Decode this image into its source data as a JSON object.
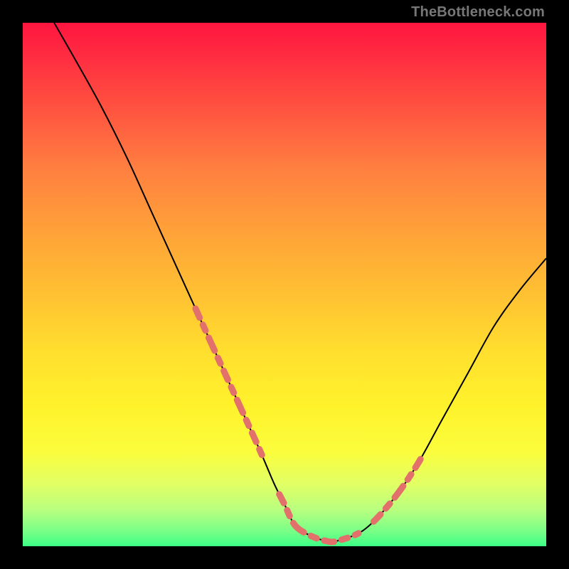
{
  "watermark": "TheBottleneck.com",
  "colors": {
    "background": "#000000",
    "curve_stroke": "#000000",
    "dash_stroke": "#e2716c"
  },
  "chart_data": {
    "type": "line",
    "xlabel": "",
    "ylabel": "",
    "xlim": [
      0,
      100
    ],
    "ylim": [
      0,
      100
    ],
    "series": [
      {
        "name": "bottleneck-curve",
        "x": [
          6,
          10,
          15,
          20,
          25,
          30,
          35,
          40,
          45,
          48,
          50,
          52,
          55,
          58,
          60,
          65,
          70,
          75,
          80,
          85,
          90,
          95,
          100
        ],
        "values": [
          100,
          93,
          84,
          74,
          63,
          52,
          41,
          30,
          19,
          12,
          8,
          4,
          2,
          1,
          1,
          3,
          8,
          15,
          24,
          33,
          42,
          49,
          55
        ]
      }
    ],
    "dash_segments": {
      "left": {
        "x_range": [
          33,
          46
        ],
        "note": "dashed overlay on left descending limb"
      },
      "floor": {
        "x_range": [
          49,
          64
        ],
        "note": "dashed overlay across trough"
      },
      "right": {
        "x_range": [
          67,
          76
        ],
        "note": "dashed overlay on right ascending limb"
      }
    },
    "title": "",
    "grid": false,
    "legend": false
  }
}
